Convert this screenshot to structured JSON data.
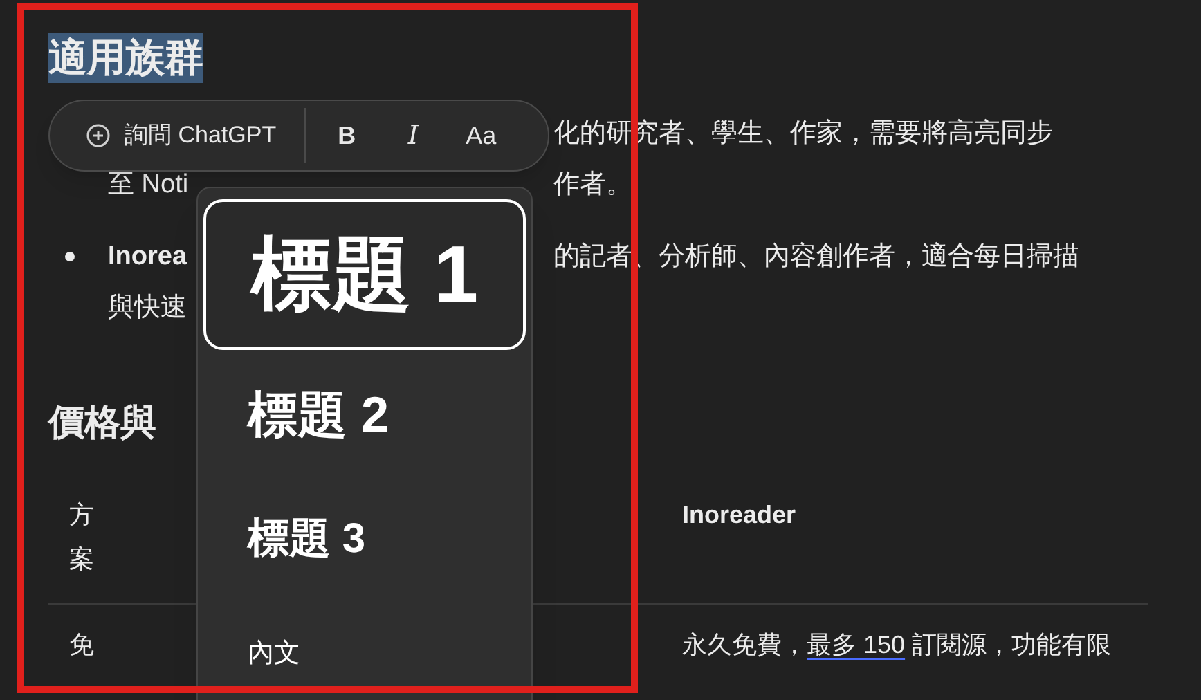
{
  "heading": {
    "text": "適用族群",
    "selected": true
  },
  "bullets": [
    {
      "dot": false,
      "lines": [
        {
          "right": "化的研究者、學生、作家，需要將高亮同步"
        },
        {
          "left": "至 Noti",
          "right": "作者。"
        }
      ]
    },
    {
      "dot": true,
      "lines": [
        {
          "lead": "Inorea",
          "right": "的記者、分析師、內容創作者，適合每日掃描"
        },
        {
          "left": "與快速"
        }
      ]
    }
  ],
  "section_heading": "價格與",
  "table": {
    "columns": [
      "方案",
      "Inoreader"
    ],
    "rows": [
      {
        "plan": "免",
        "before": "永久免費，",
        "link": "最多 150",
        "after": " 訂閱源，功能有限"
      }
    ]
  },
  "toolbar": {
    "items": [
      {
        "kind": "ask",
        "label": "詢問 ChatGPT"
      },
      {
        "kind": "bold",
        "label": "B"
      },
      {
        "kind": "italic",
        "label": "I"
      },
      {
        "kind": "font",
        "label": "Aa"
      }
    ]
  },
  "menu": {
    "items": [
      {
        "kind": "h1",
        "label": "標題 1",
        "selected": true
      },
      {
        "kind": "h2",
        "label": "標題 2",
        "selected": false
      },
      {
        "kind": "h3",
        "label": "標題 3",
        "selected": false
      },
      {
        "kind": "body",
        "label": "內文",
        "selected": false
      }
    ]
  }
}
